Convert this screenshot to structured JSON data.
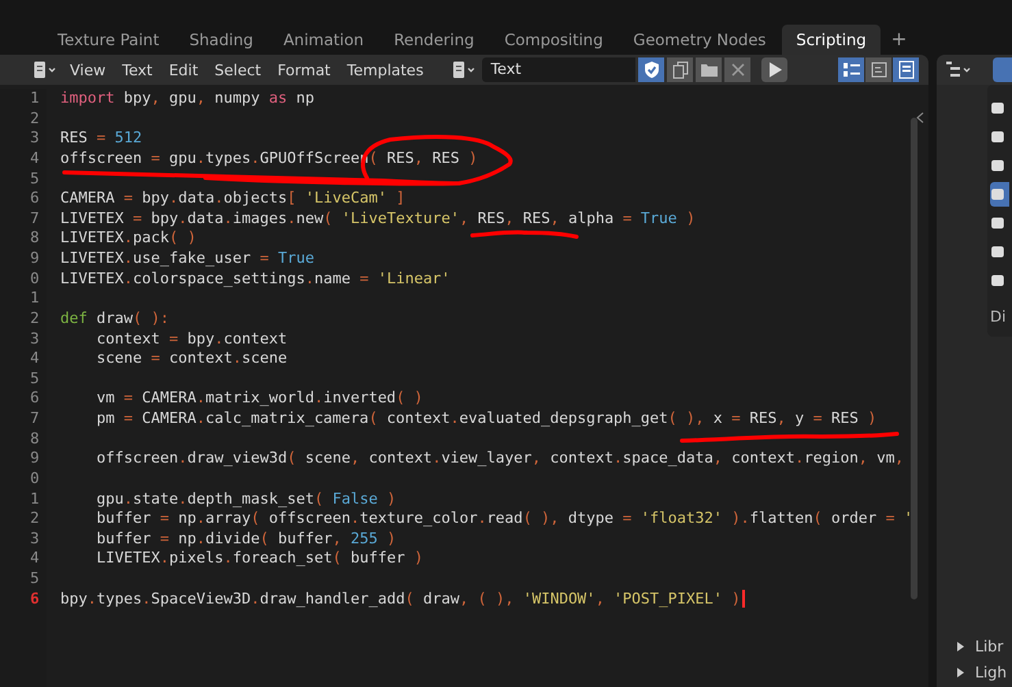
{
  "workspace_tabs": [
    {
      "label": "Texture Paint",
      "selected": false
    },
    {
      "label": "Shading",
      "selected": false
    },
    {
      "label": "Animation",
      "selected": false
    },
    {
      "label": "Rendering",
      "selected": false
    },
    {
      "label": "Compositing",
      "selected": false
    },
    {
      "label": "Geometry Nodes",
      "selected": false
    },
    {
      "label": "Scripting",
      "selected": true
    }
  ],
  "add_tab": "+",
  "text_editor": {
    "menus": [
      "View",
      "Text",
      "Edit",
      "Select",
      "Format",
      "Templates"
    ],
    "text_name": "Text",
    "fake_user": true,
    "toggles": [
      {
        "kind": "line_numbers",
        "on": true
      },
      {
        "kind": "word_wrap",
        "on": false
      },
      {
        "kind": "syntax_highlight",
        "on": true
      }
    ],
    "lines": [
      {
        "number": "1",
        "current": false,
        "tokens": [
          {
            "kind": "kw",
            "text": "import"
          },
          {
            "kind": "n",
            "text": " bpy"
          },
          {
            "kind": "p",
            "text": ","
          },
          {
            "kind": "n",
            "text": " gpu"
          },
          {
            "kind": "p",
            "text": ","
          },
          {
            "kind": "n",
            "text": " numpy "
          },
          {
            "kind": "kw",
            "text": "as"
          },
          {
            "kind": "n",
            "text": " np"
          }
        ]
      },
      {
        "number": "2",
        "current": false
      },
      {
        "number": "3",
        "current": false,
        "tokens": [
          {
            "kind": "n",
            "text": "RES "
          },
          {
            "kind": "p",
            "text": "="
          },
          {
            "kind": "num",
            "text": " 512"
          }
        ]
      },
      {
        "number": "4",
        "current": false,
        "tokens": [
          {
            "kind": "n",
            "text": "offscreen "
          },
          {
            "kind": "p",
            "text": "="
          },
          {
            "kind": "n",
            "text": " gpu"
          },
          {
            "kind": "p",
            "text": "."
          },
          {
            "kind": "n",
            "text": "types"
          },
          {
            "kind": "p",
            "text": "."
          },
          {
            "kind": "n",
            "text": "GPUOffScreen"
          },
          {
            "kind": "p",
            "text": "("
          },
          {
            "kind": "n",
            "text": " RES"
          },
          {
            "kind": "p",
            "text": ","
          },
          {
            "kind": "n",
            "text": " RES "
          },
          {
            "kind": "p",
            "text": ")"
          }
        ]
      },
      {
        "number": "5",
        "current": false
      },
      {
        "number": "6",
        "current": false,
        "tokens": [
          {
            "kind": "n",
            "text": "CAMERA "
          },
          {
            "kind": "p",
            "text": "="
          },
          {
            "kind": "n",
            "text": " bpy"
          },
          {
            "kind": "p",
            "text": "."
          },
          {
            "kind": "n",
            "text": "data"
          },
          {
            "kind": "p",
            "text": "."
          },
          {
            "kind": "n",
            "text": "objects"
          },
          {
            "kind": "p",
            "text": "["
          },
          {
            "kind": "str",
            "text": " 'LiveCam' "
          },
          {
            "kind": "p",
            "text": "]"
          }
        ]
      },
      {
        "number": "7",
        "current": false,
        "tokens": [
          {
            "kind": "n",
            "text": "LIVETEX "
          },
          {
            "kind": "p",
            "text": "="
          },
          {
            "kind": "n",
            "text": " bpy"
          },
          {
            "kind": "p",
            "text": "."
          },
          {
            "kind": "n",
            "text": "data"
          },
          {
            "kind": "p",
            "text": "."
          },
          {
            "kind": "n",
            "text": "images"
          },
          {
            "kind": "p",
            "text": "."
          },
          {
            "kind": "n",
            "text": "new"
          },
          {
            "kind": "p",
            "text": "("
          },
          {
            "kind": "str",
            "text": " 'LiveTexture'"
          },
          {
            "kind": "p",
            "text": ","
          },
          {
            "kind": "n",
            "text": " RES"
          },
          {
            "kind": "p",
            "text": ","
          },
          {
            "kind": "n",
            "text": " RES"
          },
          {
            "kind": "p",
            "text": ","
          },
          {
            "kind": "n",
            "text": " alpha "
          },
          {
            "kind": "p",
            "text": "="
          },
          {
            "kind": "num",
            "text": " True "
          },
          {
            "kind": "p",
            "text": ")"
          }
        ]
      },
      {
        "number": "8",
        "current": false,
        "tokens": [
          {
            "kind": "n",
            "text": "LIVETEX"
          },
          {
            "kind": "p",
            "text": "."
          },
          {
            "kind": "n",
            "text": "pack"
          },
          {
            "kind": "p",
            "text": "( )"
          }
        ]
      },
      {
        "number": "9",
        "current": false,
        "tokens": [
          {
            "kind": "n",
            "text": "LIVETEX"
          },
          {
            "kind": "p",
            "text": "."
          },
          {
            "kind": "n",
            "text": "use_fake_user "
          },
          {
            "kind": "p",
            "text": "="
          },
          {
            "kind": "num",
            "text": " True"
          }
        ]
      },
      {
        "number": "0",
        "current": false,
        "tokens": [
          {
            "kind": "n",
            "text": "LIVETEX"
          },
          {
            "kind": "p",
            "text": "."
          },
          {
            "kind": "n",
            "text": "colorspace_settings"
          },
          {
            "kind": "p",
            "text": "."
          },
          {
            "kind": "n",
            "text": "name "
          },
          {
            "kind": "p",
            "text": "="
          },
          {
            "kind": "str",
            "text": " 'Linear'"
          }
        ]
      },
      {
        "number": "1",
        "current": false
      },
      {
        "number": "2",
        "current": false,
        "tokens": [
          {
            "kind": "def",
            "text": "def"
          },
          {
            "kind": "n",
            "text": " draw"
          },
          {
            "kind": "p",
            "text": "( ):"
          }
        ]
      },
      {
        "number": "3",
        "current": false,
        "tokens": [
          {
            "kind": "n",
            "text": "    context "
          },
          {
            "kind": "p",
            "text": "="
          },
          {
            "kind": "n",
            "text": " bpy"
          },
          {
            "kind": "p",
            "text": "."
          },
          {
            "kind": "n",
            "text": "context"
          }
        ]
      },
      {
        "number": "4",
        "current": false,
        "tokens": [
          {
            "kind": "n",
            "text": "    scene "
          },
          {
            "kind": "p",
            "text": "="
          },
          {
            "kind": "n",
            "text": " context"
          },
          {
            "kind": "p",
            "text": "."
          },
          {
            "kind": "n",
            "text": "scene"
          }
        ]
      },
      {
        "number": "5",
        "current": false
      },
      {
        "number": "6",
        "current": false,
        "tokens": [
          {
            "kind": "n",
            "text": "    vm "
          },
          {
            "kind": "p",
            "text": "="
          },
          {
            "kind": "n",
            "text": " CAMERA"
          },
          {
            "kind": "p",
            "text": "."
          },
          {
            "kind": "n",
            "text": "matrix_world"
          },
          {
            "kind": "p",
            "text": "."
          },
          {
            "kind": "n",
            "text": "inverted"
          },
          {
            "kind": "p",
            "text": "( )"
          }
        ]
      },
      {
        "number": "7",
        "current": false,
        "tokens": [
          {
            "kind": "n",
            "text": "    pm "
          },
          {
            "kind": "p",
            "text": "="
          },
          {
            "kind": "n",
            "text": " CAMERA"
          },
          {
            "kind": "p",
            "text": "."
          },
          {
            "kind": "n",
            "text": "calc_matrix_camera"
          },
          {
            "kind": "p",
            "text": "("
          },
          {
            "kind": "n",
            "text": " context"
          },
          {
            "kind": "p",
            "text": "."
          },
          {
            "kind": "n",
            "text": "evaluated_depsgraph_get"
          },
          {
            "kind": "p",
            "text": "( ),"
          },
          {
            "kind": "n",
            "text": " x "
          },
          {
            "kind": "p",
            "text": "="
          },
          {
            "kind": "n",
            "text": " RES"
          },
          {
            "kind": "p",
            "text": ","
          },
          {
            "kind": "n",
            "text": " y "
          },
          {
            "kind": "p",
            "text": "="
          },
          {
            "kind": "n",
            "text": " RES "
          },
          {
            "kind": "p",
            "text": ")"
          }
        ]
      },
      {
        "number": "8",
        "current": false
      },
      {
        "number": "9",
        "current": false,
        "tokens": [
          {
            "kind": "n",
            "text": "    offscreen"
          },
          {
            "kind": "p",
            "text": "."
          },
          {
            "kind": "n",
            "text": "draw_view3d"
          },
          {
            "kind": "p",
            "text": "("
          },
          {
            "kind": "n",
            "text": " scene"
          },
          {
            "kind": "p",
            "text": ","
          },
          {
            "kind": "n",
            "text": " context"
          },
          {
            "kind": "p",
            "text": "."
          },
          {
            "kind": "n",
            "text": "view_layer"
          },
          {
            "kind": "p",
            "text": ","
          },
          {
            "kind": "n",
            "text": " context"
          },
          {
            "kind": "p",
            "text": "."
          },
          {
            "kind": "n",
            "text": "space_data"
          },
          {
            "kind": "p",
            "text": ","
          },
          {
            "kind": "n",
            "text": " context"
          },
          {
            "kind": "p",
            "text": "."
          },
          {
            "kind": "n",
            "text": "region"
          },
          {
            "kind": "p",
            "text": ","
          },
          {
            "kind": "n",
            "text": " vm"
          },
          {
            "kind": "p",
            "text": ","
          }
        ]
      },
      {
        "number": "0",
        "current": false
      },
      {
        "number": "1",
        "current": false,
        "tokens": [
          {
            "kind": "n",
            "text": "    gpu"
          },
          {
            "kind": "p",
            "text": "."
          },
          {
            "kind": "n",
            "text": "state"
          },
          {
            "kind": "p",
            "text": "."
          },
          {
            "kind": "n",
            "text": "depth_mask_set"
          },
          {
            "kind": "p",
            "text": "("
          },
          {
            "kind": "num",
            "text": " False "
          },
          {
            "kind": "p",
            "text": ")"
          }
        ]
      },
      {
        "number": "2",
        "current": false,
        "tokens": [
          {
            "kind": "n",
            "text": "    buffer "
          },
          {
            "kind": "p",
            "text": "="
          },
          {
            "kind": "n",
            "text": " np"
          },
          {
            "kind": "p",
            "text": "."
          },
          {
            "kind": "n",
            "text": "array"
          },
          {
            "kind": "p",
            "text": "("
          },
          {
            "kind": "n",
            "text": " offscreen"
          },
          {
            "kind": "p",
            "text": "."
          },
          {
            "kind": "n",
            "text": "texture_color"
          },
          {
            "kind": "p",
            "text": "."
          },
          {
            "kind": "n",
            "text": "read"
          },
          {
            "kind": "p",
            "text": "( ),"
          },
          {
            "kind": "n",
            "text": " dtype "
          },
          {
            "kind": "p",
            "text": "="
          },
          {
            "kind": "str",
            "text": " 'float32' "
          },
          {
            "kind": "p",
            "text": ")."
          },
          {
            "kind": "n",
            "text": "flatten"
          },
          {
            "kind": "p",
            "text": "("
          },
          {
            "kind": "n",
            "text": " order "
          },
          {
            "kind": "p",
            "text": "="
          },
          {
            "kind": "str",
            "text": " '"
          }
        ]
      },
      {
        "number": "3",
        "current": false,
        "tokens": [
          {
            "kind": "n",
            "text": "    buffer "
          },
          {
            "kind": "p",
            "text": "="
          },
          {
            "kind": "n",
            "text": " np"
          },
          {
            "kind": "p",
            "text": "."
          },
          {
            "kind": "n",
            "text": "divide"
          },
          {
            "kind": "p",
            "text": "("
          },
          {
            "kind": "n",
            "text": " buffer"
          },
          {
            "kind": "p",
            "text": ","
          },
          {
            "kind": "num",
            "text": " 255 "
          },
          {
            "kind": "p",
            "text": ")"
          }
        ]
      },
      {
        "number": "4",
        "current": false,
        "tokens": [
          {
            "kind": "n",
            "text": "    LIVETEX"
          },
          {
            "kind": "p",
            "text": "."
          },
          {
            "kind": "n",
            "text": "pixels"
          },
          {
            "kind": "p",
            "text": "."
          },
          {
            "kind": "n",
            "text": "foreach_set"
          },
          {
            "kind": "p",
            "text": "("
          },
          {
            "kind": "n",
            "text": " buffer "
          },
          {
            "kind": "p",
            "text": ")"
          }
        ]
      },
      {
        "number": "5",
        "current": false
      },
      {
        "number": "6",
        "current": true,
        "tokens": [
          {
            "kind": "n",
            "text": "bpy"
          },
          {
            "kind": "p",
            "text": "."
          },
          {
            "kind": "n",
            "text": "types"
          },
          {
            "kind": "p",
            "text": "."
          },
          {
            "kind": "n",
            "text": "SpaceView3D"
          },
          {
            "kind": "p",
            "text": "."
          },
          {
            "kind": "n",
            "text": "draw_handler_add"
          },
          {
            "kind": "p",
            "text": "("
          },
          {
            "kind": "n",
            "text": " draw"
          },
          {
            "kind": "p",
            "text": ", ( ),"
          },
          {
            "kind": "str",
            "text": " 'WINDOW'"
          },
          {
            "kind": "p",
            "text": ","
          },
          {
            "kind": "str",
            "text": " 'POST_PIXEL' "
          },
          {
            "kind": "p",
            "text": ")"
          }
        ]
      }
    ]
  },
  "properties_tabs": [
    {
      "selected": false
    },
    {
      "selected": false
    },
    {
      "selected": false
    },
    {
      "selected": true
    },
    {
      "selected": false
    },
    {
      "selected": false
    },
    {
      "selected": false
    }
  ],
  "properties_label": "Di",
  "outliner": {
    "items": [
      {
        "label": "Libr",
        "expanded": false
      },
      {
        "label": "Ligh",
        "expanded": false
      }
    ]
  }
}
